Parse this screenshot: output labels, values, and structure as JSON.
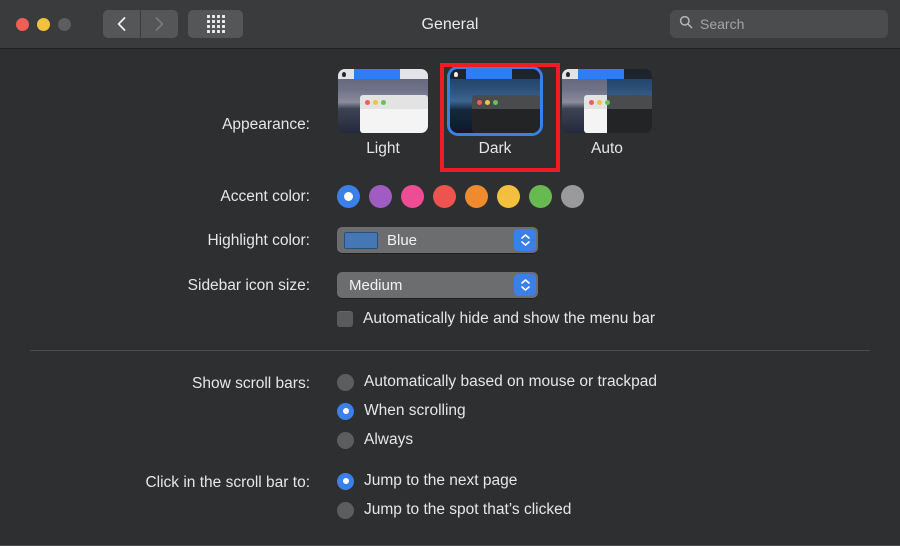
{
  "window": {
    "title": "General",
    "background_color": "#2e2f30",
    "titlebar_color": "#3a3b3d"
  },
  "titlebar": {
    "traffic_lights": [
      {
        "name": "close",
        "color": "#ee5f56"
      },
      {
        "name": "minimize",
        "color": "#f1c23f"
      },
      {
        "name": "zoom",
        "color": "#5c5d5f"
      }
    ],
    "back_button": "back-icon",
    "forward_button": "forward-icon",
    "grid_button": "show-all-icon",
    "search": {
      "placeholder": "Search",
      "value": "",
      "icon": "search-icon"
    }
  },
  "appearance": {
    "label": "Appearance:",
    "selected": "Dark",
    "options": [
      {
        "name": "Light",
        "mode": "light"
      },
      {
        "name": "Dark",
        "mode": "dark"
      },
      {
        "name": "Auto",
        "mode": "auto"
      }
    ],
    "annotation_color": "#ee1c25"
  },
  "accent_color": {
    "label": "Accent color:",
    "selected_index": 0,
    "swatches": [
      {
        "name": "blue",
        "color": "#3b7fe8"
      },
      {
        "name": "purple",
        "color": "#a05cc0"
      },
      {
        "name": "pink",
        "color": "#ee4d95"
      },
      {
        "name": "red",
        "color": "#ee5350"
      },
      {
        "name": "orange",
        "color": "#ef8b2c"
      },
      {
        "name": "yellow",
        "color": "#f3c03e"
      },
      {
        "name": "green",
        "color": "#69b952"
      },
      {
        "name": "graphite",
        "color": "#9a9a9c"
      }
    ]
  },
  "highlight_color": {
    "label": "Highlight color:",
    "value": "Blue",
    "chip_color": "#4477b3"
  },
  "sidebar_icon_size": {
    "label": "Sidebar icon size:",
    "value": "Medium"
  },
  "menu_bar_checkbox": {
    "label": "Automatically hide and show the menu bar",
    "checked": false
  },
  "show_scroll_bars": {
    "label": "Show scroll bars:",
    "selected": "When scrolling",
    "options": [
      "Automatically based on mouse or trackpad",
      "When scrolling",
      "Always"
    ]
  },
  "click_scroll_bar": {
    "label": "Click in the scroll bar to:",
    "selected": "Jump to the next page",
    "options": [
      "Jump to the next page",
      "Jump to the spot that’s clicked"
    ]
  }
}
